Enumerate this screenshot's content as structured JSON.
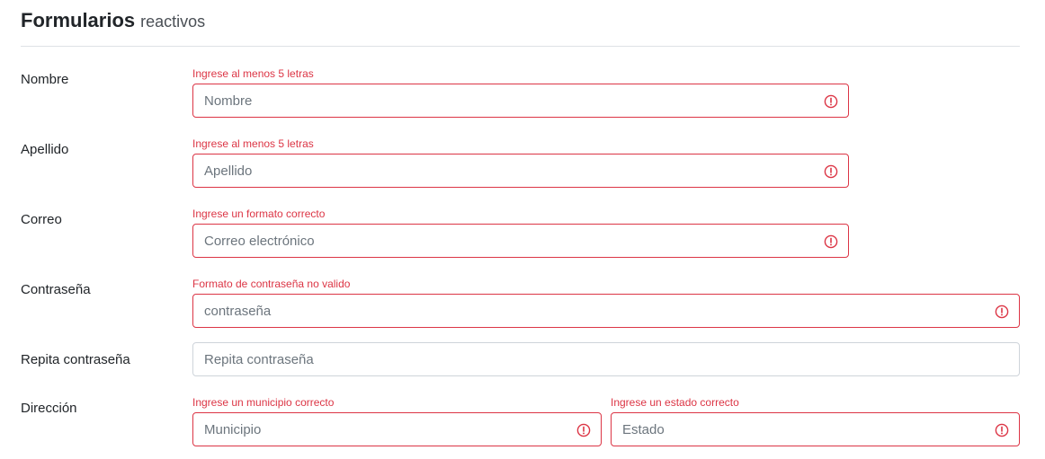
{
  "header": {
    "title": "Formularios",
    "subtitle": "reactivos"
  },
  "colors": {
    "error": "#dc3545",
    "border_valid": "#ced4da",
    "text": "#212529",
    "placeholder": "#6c757d"
  },
  "form": {
    "nombre": {
      "label": "Nombre",
      "error": "Ingrese al menos 5 letras",
      "placeholder": "Nombre",
      "value": "",
      "status_icon": "exclamation-circle-icon"
    },
    "apellido": {
      "label": "Apellido",
      "error": "Ingrese al menos 5 letras",
      "placeholder": "Apellido",
      "value": "",
      "status_icon": "exclamation-circle-icon"
    },
    "correo": {
      "label": "Correo",
      "error": "Ingrese un formato correcto",
      "placeholder": "Correo electrónico",
      "value": "",
      "status_icon": "exclamation-circle-icon"
    },
    "contrasena": {
      "label": "Contraseña",
      "error": "Formato de contraseña no valido",
      "placeholder": "contraseña",
      "value": "",
      "status_icon": "exclamation-circle-icon"
    },
    "repita": {
      "label": "Repita contraseña",
      "placeholder": "Repita contraseña",
      "value": ""
    },
    "direccion": {
      "label": "Dirección",
      "municipio": {
        "error": "Ingrese un municipio correcto",
        "placeholder": "Municipio",
        "value": "",
        "status_icon": "exclamation-circle-icon"
      },
      "estado": {
        "error": "Ingrese un estado correcto",
        "placeholder": "Estado",
        "value": "",
        "status_icon": "exclamation-circle-icon"
      }
    }
  }
}
